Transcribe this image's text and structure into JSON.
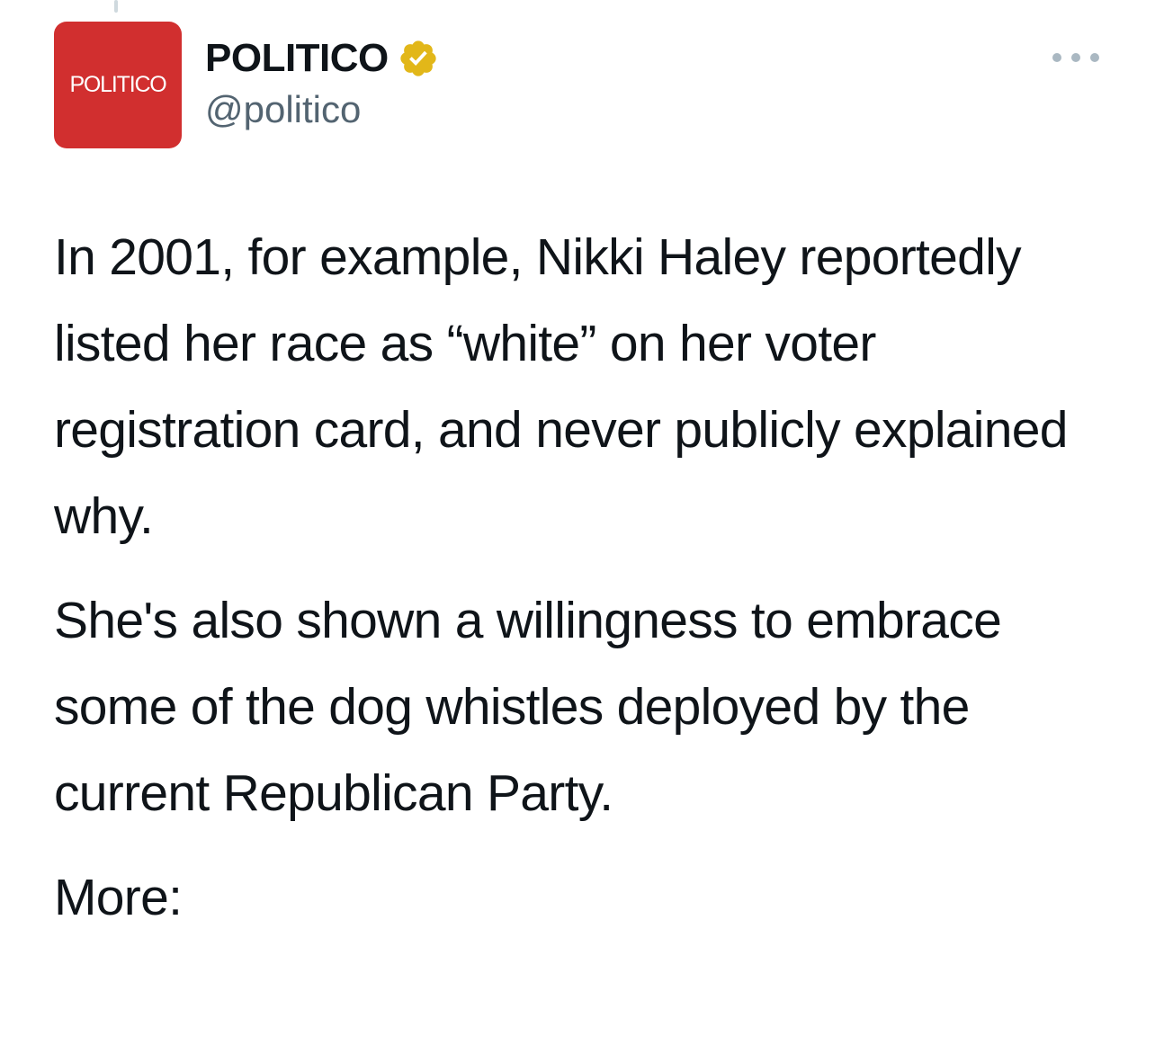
{
  "author": {
    "avatar_text": "POLITICO",
    "display_name": "POLITICO",
    "verified_icon": "verified-badge-icon",
    "handle": "@politico",
    "brand_color": "#d12f2f",
    "badge_color": "#e2b719"
  },
  "menu": {
    "icon": "more-options-icon"
  },
  "tweet": {
    "paragraphs": [
      "In 2001, for example, Nikki Haley reportedly listed her race as “white” on her voter registration card, and never publicly explained why.",
      "She's also shown a willingness to embrace some of the dog whistles deployed by the current Republican Party.",
      "More:"
    ]
  }
}
